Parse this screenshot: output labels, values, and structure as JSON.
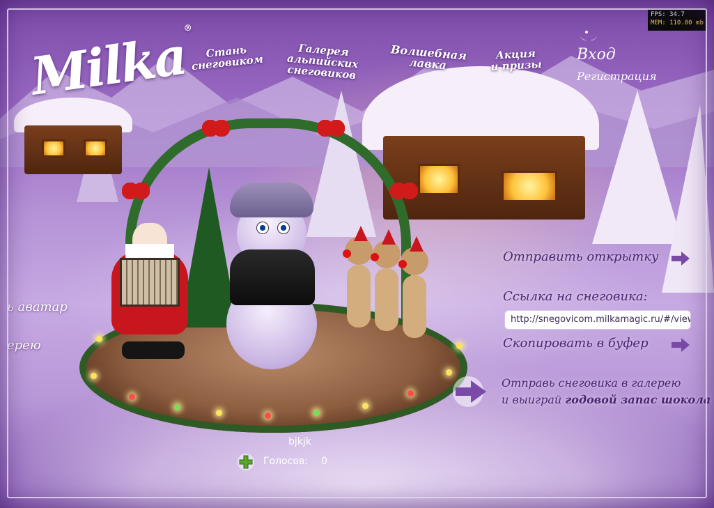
{
  "window": {
    "title": "Milka"
  },
  "debug": {
    "fps_label": "FPS: 34.7",
    "mem_label": "MEM: 110.00 mb"
  },
  "brand": {
    "logo": "Milka",
    "registered": "®"
  },
  "nav": {
    "items": [
      {
        "id": "snowman",
        "line1": "Стань",
        "line2": "снеговиком"
      },
      {
        "id": "gallery",
        "line1": "Галерея",
        "line2": "альпийских",
        "line3": "снеговиков"
      },
      {
        "id": "shop",
        "line1": "Волшебная",
        "line2": "лавка"
      },
      {
        "id": "promo",
        "line1": "Акция",
        "line2": "и призы"
      }
    ]
  },
  "auth": {
    "login": "Вход",
    "register": "Регистрация"
  },
  "left_panel": {
    "avatar_label": "ь аватар",
    "gallery_label": "ерею"
  },
  "share": {
    "send_card": "Отправить открытку",
    "link_label": "Ссылка на снеговика:",
    "link_value": "http://snegovicom.milkamagic.ru/#/view",
    "copy_label": "Скопировать в буфер",
    "gallery_cta_line1": "Отправь снеговика в галерею",
    "gallery_cta_line2_prefix": "и выиграй ",
    "gallery_cta_line2_bold": "годовой запас шокола"
  },
  "snowman": {
    "name": "bjkjk",
    "votes_label": "Голосов:",
    "votes_count": "0"
  },
  "colors": {
    "accent_purple": "#4a2672",
    "arrow_purple": "#7a4aa8",
    "plus_green": "#5aa52c"
  }
}
